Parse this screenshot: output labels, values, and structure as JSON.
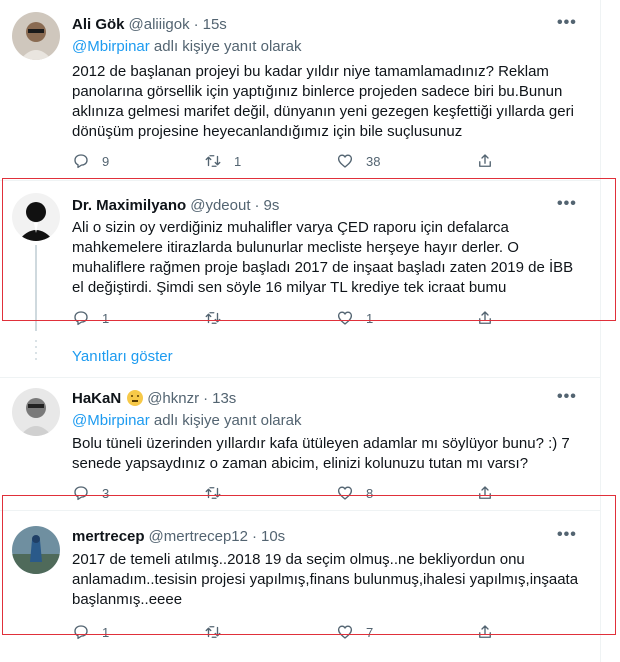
{
  "tweets": [
    {
      "name": "Ali Gök",
      "handle": "@aliiigok",
      "time": "15s",
      "reply_prefix_mention": "@Mbirpinar",
      "reply_suffix": "adlı kişiye yanıt olarak",
      "text": "2012 de başlanan projeyi bu kadar yıldır niye tamamlamadınız? Reklam panolarına görsellik için yaptığınız binlerce projeden sadece biri bu.Bunun aklınıza gelmesi marifet değil, dünyanın yeni gezegen keşfettiği yıllarda geri dönüşüm projesine heyecanlandığımız için bile suçlusunuz",
      "replies": "9",
      "retweets": "1",
      "likes": "38"
    },
    {
      "name": "Dr. Maximilyano",
      "handle": "@ydeout",
      "time": "9s",
      "text": "Ali o sizin oy verdiğiniz muhalifler varya ÇED raporu için defalarca mahkemelere itirazlarda bulunurlar mecliste herşeye hayır derler. O muhaliflere rağmen proje başladı 2017 de inşaat başladı zaten 2019 de İBB el değiştirdi. Şimdi sen söyle 16 milyar TL krediye tek icraat bumu",
      "replies": "1",
      "retweets": "",
      "likes": "1"
    },
    {
      "name": "HaKaN",
      "handle": "@hknzr",
      "time": "13s",
      "reply_prefix_mention": "@Mbirpinar",
      "reply_suffix": "adlı kişiye yanıt olarak",
      "text": "Bolu tüneli üzerinden yıllardır kafa ütüleyen adamlar mı söylüyor bunu? :) 7 senede yapsaydınız o zaman abicim, elinizi kolunuzu tutan mı varsı?",
      "replies": "3",
      "retweets": "",
      "likes": "8"
    },
    {
      "name": "mertrecep",
      "handle": "@mertrecep12",
      "time": "10s",
      "text": "2017 de temeli atılmış..2018 19 da seçim olmuş..ne bekliyordun onu anlamadım..tesisin projesi yapılmış,finans bulunmuş,ihalesi yapılmış,inşaata başlanmış..eeee",
      "replies": "1",
      "retweets": "",
      "likes": "7"
    }
  ],
  "show_replies": "Yanıtları göster",
  "dot": "·",
  "more": "•••",
  "colors": {
    "accent": "#1d9bf0",
    "highlight_box": "#e0303a",
    "muted": "#536471"
  }
}
